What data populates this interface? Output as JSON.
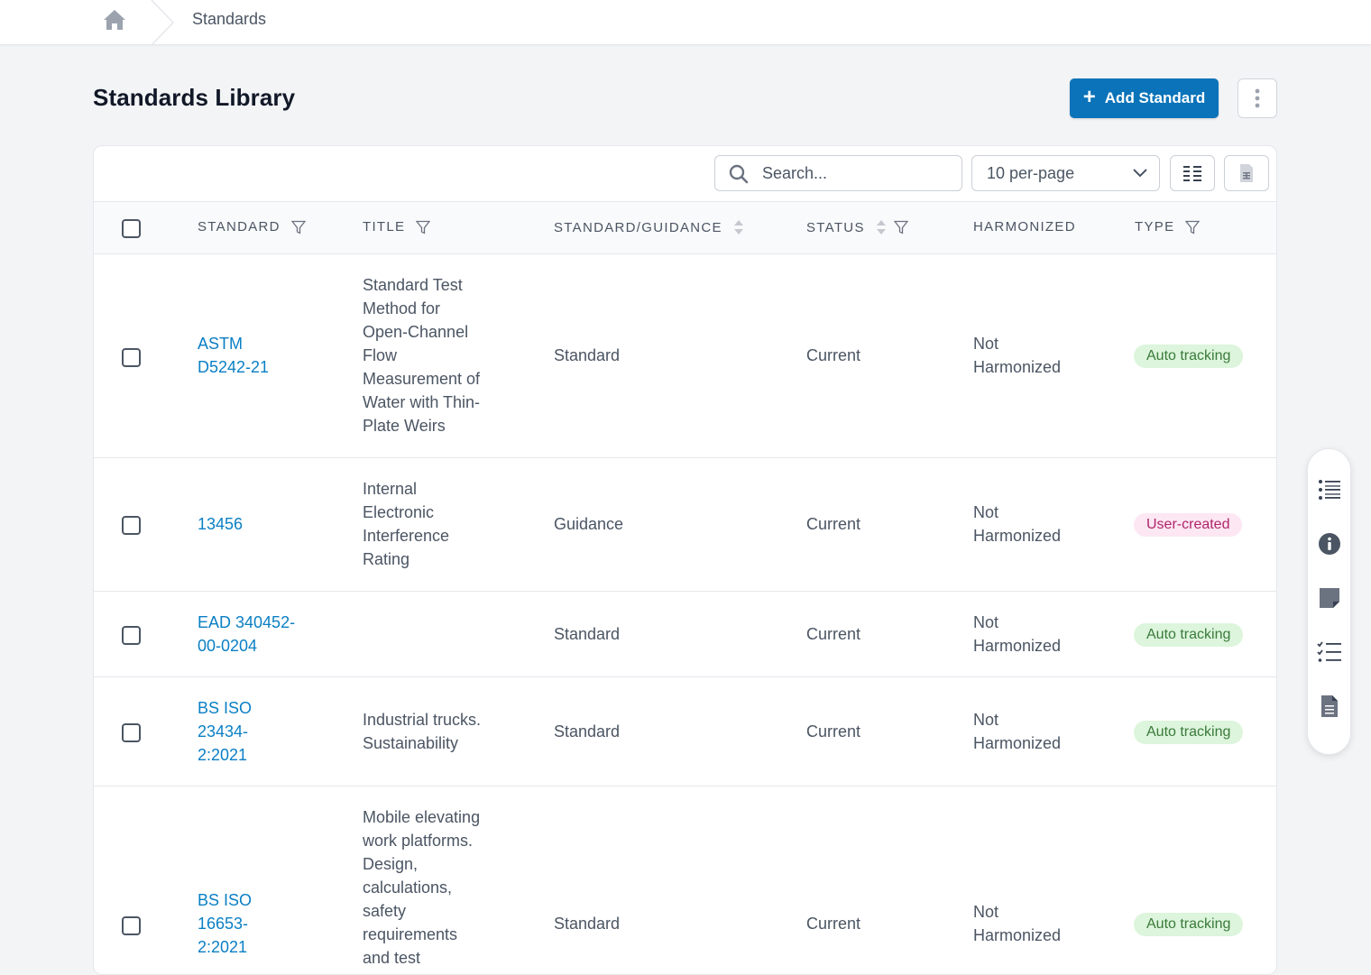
{
  "breadcrumb": {
    "current": "Standards"
  },
  "header": {
    "title": "Standards Library",
    "add_button": "Add Standard"
  },
  "toolbar": {
    "search_placeholder": "Search...",
    "per_page": "10 per-page"
  },
  "table": {
    "columns": [
      "STANDARD",
      "TITLE",
      "STANDARD/GUIDANCE",
      "STATUS",
      "HARMONIZED",
      "TYPE"
    ],
    "rows": [
      {
        "standard": [
          "ASTM",
          "D5242-21"
        ],
        "title": [
          "Standard Test",
          "Method for",
          "Open-Channel",
          "Flow",
          "Measurement of",
          "Water with Thin-",
          "Plate Weirs"
        ],
        "kind": "Standard",
        "status": "Current",
        "harmonized": [
          "Not",
          "Harmonized"
        ],
        "type": "Auto tracking"
      },
      {
        "standard": [
          "13456"
        ],
        "title": [
          "Internal",
          "Electronic",
          "Interference",
          "Rating"
        ],
        "kind": "Guidance",
        "status": "Current",
        "harmonized": [
          "Not",
          "Harmonized"
        ],
        "type": "User-created"
      },
      {
        "standard": [
          "EAD 340452-",
          "00-0204"
        ],
        "title": [],
        "kind": "Standard",
        "status": "Current",
        "harmonized": [
          "Not",
          "Harmonized"
        ],
        "type": "Auto tracking"
      },
      {
        "standard": [
          "BS ISO",
          "23434-",
          "2:2021"
        ],
        "title": [
          "Industrial trucks.",
          "Sustainability"
        ],
        "kind": "Standard",
        "status": "Current",
        "harmonized": [
          "Not",
          "Harmonized"
        ],
        "type": "Auto tracking"
      },
      {
        "standard": [
          "BS ISO",
          "16653-",
          "2:2021"
        ],
        "title": [
          "Mobile elevating",
          "work platforms.",
          "Design,",
          "calculations,",
          "safety",
          "requirements",
          "and test"
        ],
        "kind": "Standard",
        "status": "Current",
        "harmonized": [
          "Not",
          "Harmonized"
        ],
        "type": "Auto tracking"
      }
    ]
  },
  "colors": {
    "primary": "#0a73b9",
    "link": "#0a7fc4",
    "auto_badge_bg": "#dcf5dc",
    "user_badge_bg": "#fde7f3"
  },
  "rail": {
    "icons": [
      "list-icon",
      "info-icon",
      "note-icon",
      "checklist-icon",
      "document-icon"
    ]
  }
}
